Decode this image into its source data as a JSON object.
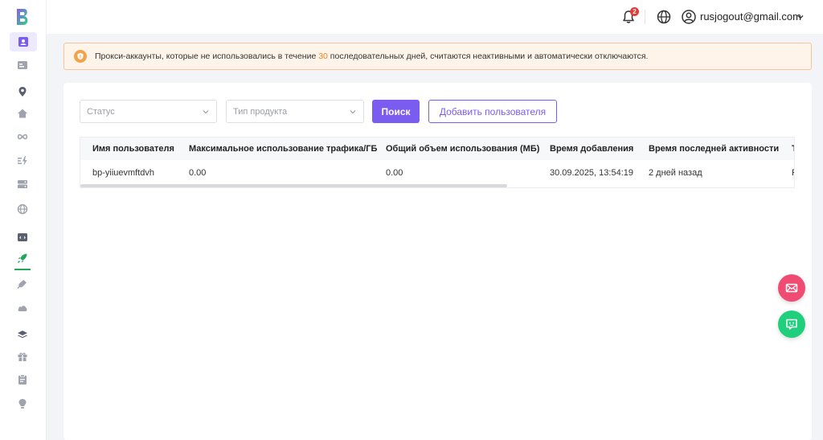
{
  "header": {
    "notification_count": "2",
    "user_email": "rusjogout@gmail.com"
  },
  "notice": {
    "text_before": "Прокси-аккаунты, которые не использовались в течение ",
    "days": "30",
    "text_after": " последовательных дней, считаются неактивными и автоматически отключаются."
  },
  "filters": {
    "status_placeholder": "Статус",
    "product_type_placeholder": "Тип продукта",
    "search_label": "Поиск",
    "add_user_label": "Добавить пользователя"
  },
  "table": {
    "columns": [
      "Имя пользователя",
      "Максимальное использование трафика/ГБ",
      "Общий объем использования (МБ)",
      "Время добавления",
      "Время последней активности",
      "Т"
    ],
    "rows": [
      [
        "bp-yiiuevmftdvh",
        "0.00",
        "0.00",
        "30.09.2025, 13:54:19",
        "2 дней назад",
        "F"
      ]
    ]
  },
  "colors": {
    "accent": "#7b5cf0",
    "notice_bg": "#fef4ea",
    "notice_highlight": "#f0801b",
    "fab_mail": "#ef4b73",
    "fab_chat": "#1fcf7c"
  }
}
